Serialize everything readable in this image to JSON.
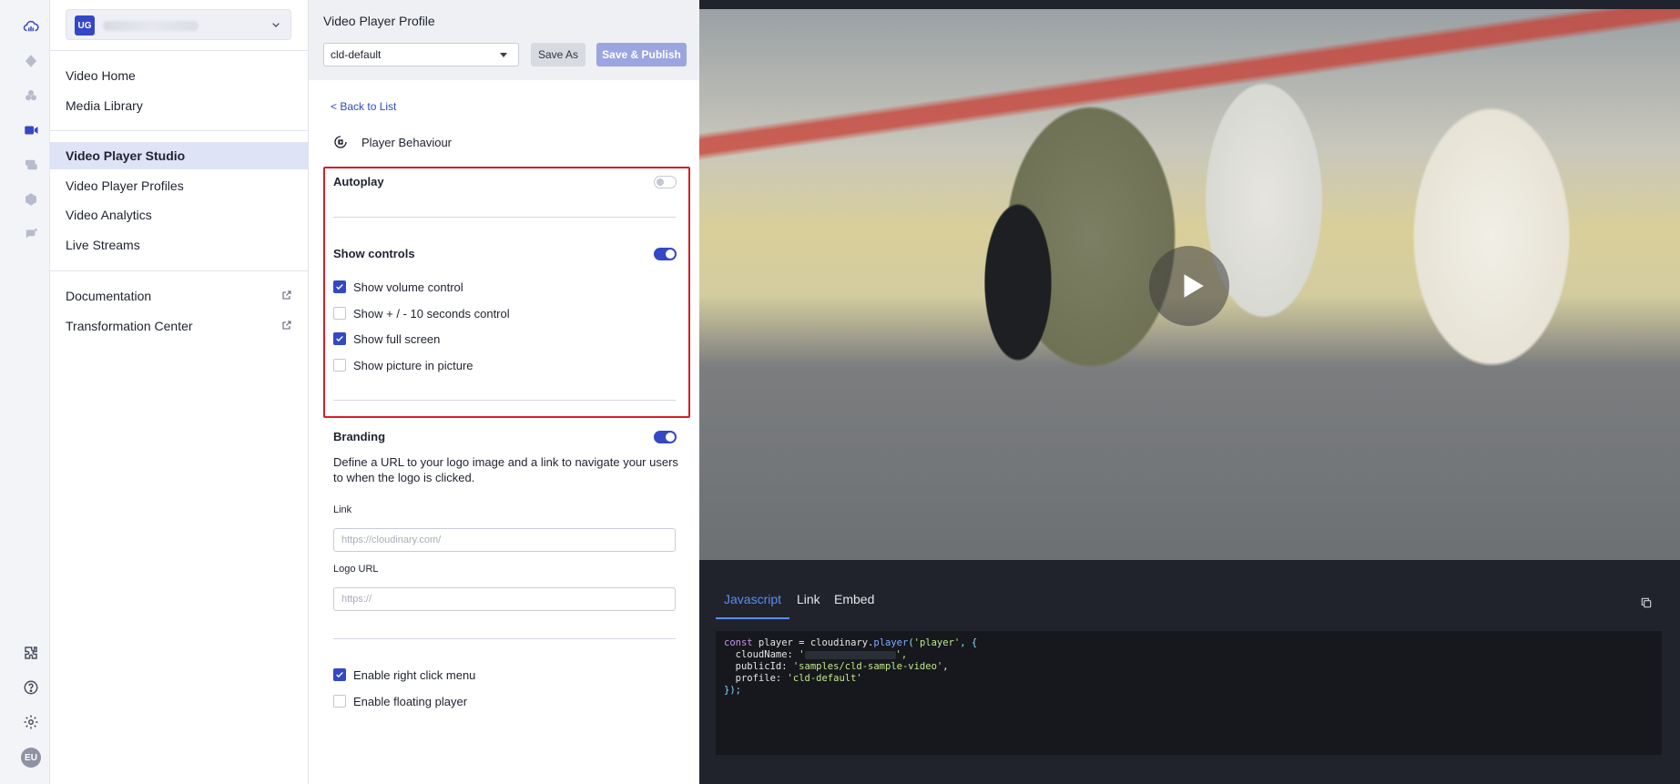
{
  "rail": {
    "icons": [
      "cloud-logo-icon",
      "diamond-icon",
      "assets-icon",
      "video-icon",
      "layers-icon",
      "globe-icon",
      "ai-sparkle-icon"
    ],
    "bottom_icons": [
      "puzzle-icon",
      "help-icon",
      "settings-icon"
    ],
    "avatar": "EU"
  },
  "sidebar": {
    "account_initials": "UG",
    "items_top": [
      "Video Home",
      "Media Library"
    ],
    "items_mid": [
      "Video Player Studio",
      "Video Player Profiles",
      "Video Analytics",
      "Live Streams"
    ],
    "items_bottom": [
      "Documentation",
      "Transformation Center"
    ],
    "active": "Video Player Studio"
  },
  "panel": {
    "title": "Video Player Profile",
    "profile_select": "cld-default",
    "save_as": "Save As",
    "save_publish": "Save & Publish",
    "back": "< Back to List",
    "section": "Player Behaviour",
    "autoplay": {
      "label": "Autoplay",
      "on": false
    },
    "show_controls": {
      "label": "Show controls",
      "on": true
    },
    "controls": [
      {
        "label": "Show volume control",
        "checked": true
      },
      {
        "label": "Show + / - 10 seconds control",
        "checked": false
      },
      {
        "label": "Show full screen",
        "checked": true
      },
      {
        "label": "Show picture in picture",
        "checked": false
      }
    ],
    "branding": {
      "label": "Branding",
      "on": true,
      "description": "Define a URL to your logo image and a link to navigate your users to when the logo is clicked.",
      "link_label": "Link",
      "link_placeholder": "https://cloudinary.com/",
      "logo_label": "Logo URL",
      "logo_placeholder": "https://"
    },
    "extras": [
      {
        "label": "Enable right click menu",
        "checked": true
      },
      {
        "label": "Enable floating player",
        "checked": false
      }
    ]
  },
  "code": {
    "tabs": [
      "Javascript",
      "Link",
      "Embed"
    ],
    "active_tab": "Javascript",
    "line1_a": "const",
    "line1_b": " player = cloudinary.",
    "line1_c": "player",
    "line1_d": "(",
    "line1_e": "'player'",
    "line1_f": ", {",
    "line2_a": "  cloudName: ",
    "line2_b": "'",
    "line2_c": "',",
    "line3_a": "  publicId: ",
    "line3_b": "'samples/cld-sample-video'",
    "line3_c": ",",
    "line4_a": "  profile: ",
    "line4_b": "'cld-default'",
    "line5": "});"
  }
}
